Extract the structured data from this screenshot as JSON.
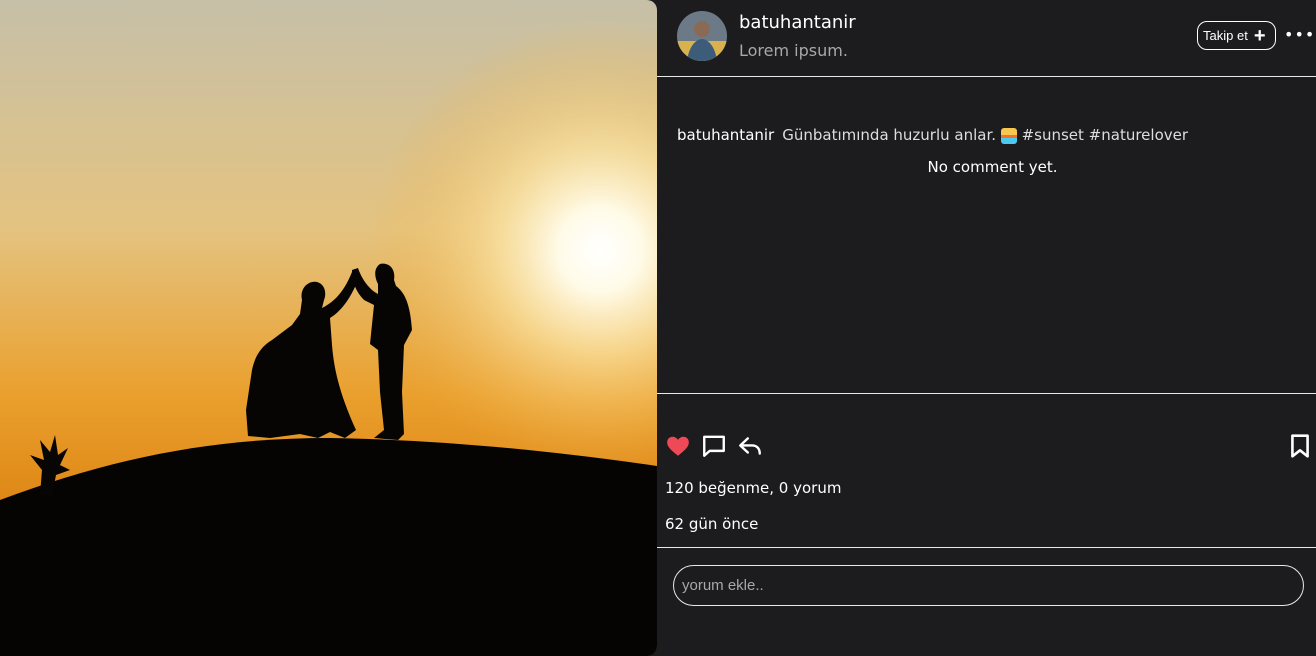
{
  "post": {
    "image_alt": "sunset couple silhouette",
    "colors": {
      "sky_top": "#c9c1a4",
      "sky_mid": "#e8a83a",
      "sky_low": "#e08a17",
      "ground": "#050403"
    }
  },
  "header": {
    "username": "batuhantanir",
    "subtitle": "Lorem ipsum.",
    "follow_label": "Takip et",
    "follow_icon": "plus-icon",
    "more_icon": "more-icon"
  },
  "caption": {
    "username": "batuhantanir",
    "text": "Günbatımında huzurlu anlar.",
    "emoji": "sunset-emoji",
    "hashtags": "#sunset #naturelover"
  },
  "comments": {
    "empty_text": "No comment yet."
  },
  "actions": {
    "like_icon": "heart-icon",
    "comment_icon": "comment-icon",
    "share_icon": "reply-icon",
    "save_icon": "bookmark-icon",
    "like_color": "#ed4956"
  },
  "stats": {
    "summary": "120 beğenme, 0 yorum",
    "time_ago": "62 gün önce"
  },
  "comment_box": {
    "placeholder": "yorum ekle.."
  }
}
